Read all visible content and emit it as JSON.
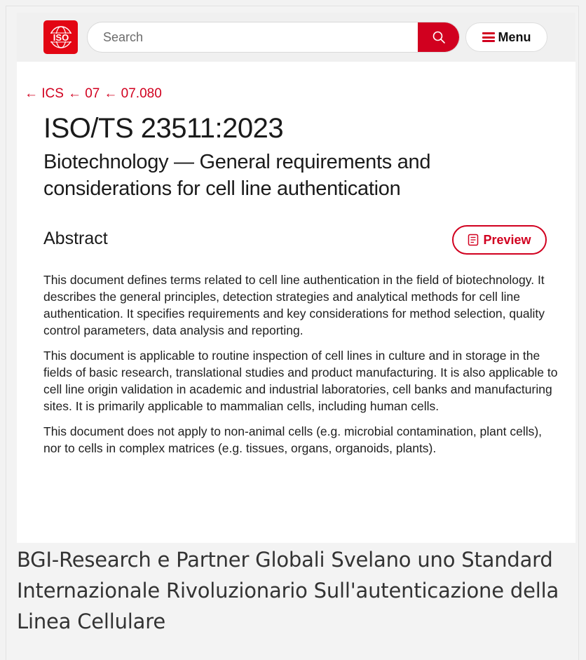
{
  "header": {
    "logo_text": "ISO",
    "search_placeholder": "Search",
    "menu_label": "Menu",
    "accent_color": "#d1001f"
  },
  "breadcrumb": [
    "← ICS",
    "← 07",
    "← 07.080"
  ],
  "document": {
    "title": "ISO/TS 23511:2023",
    "subtitle": "Biotechnology — General requirements and considerations for cell line authentication"
  },
  "abstract": {
    "heading": "Abstract",
    "preview_label": "Preview",
    "paragraphs": [
      "This document defines terms related to cell line authentication in the field of biotechnology. It describes the general principles, detection strategies and analytical methods for cell line authentication. It specifies requirements and key considerations for method selection, quality control parameters, data analysis and reporting.",
      "This document is applicable to routine inspection of cell lines in culture and in storage in the fields of basic research, translational studies and product manufacturing. It is also applicable to cell line origin validation in academic and industrial laboratories, cell banks and manufacturing sites. It is primarily applicable to mammalian cells, including human cells.",
      "This document does not apply to non-animal cells (e.g. microbial contamination, plant cells), nor to cells in complex matrices (e.g. tissues, organs, organoids, plants)."
    ]
  },
  "caption": "BGI-Research e Partner Globali Svelano uno Standard Internazionale Rivoluzionario Sull'autenticazione della Linea Cellulare"
}
